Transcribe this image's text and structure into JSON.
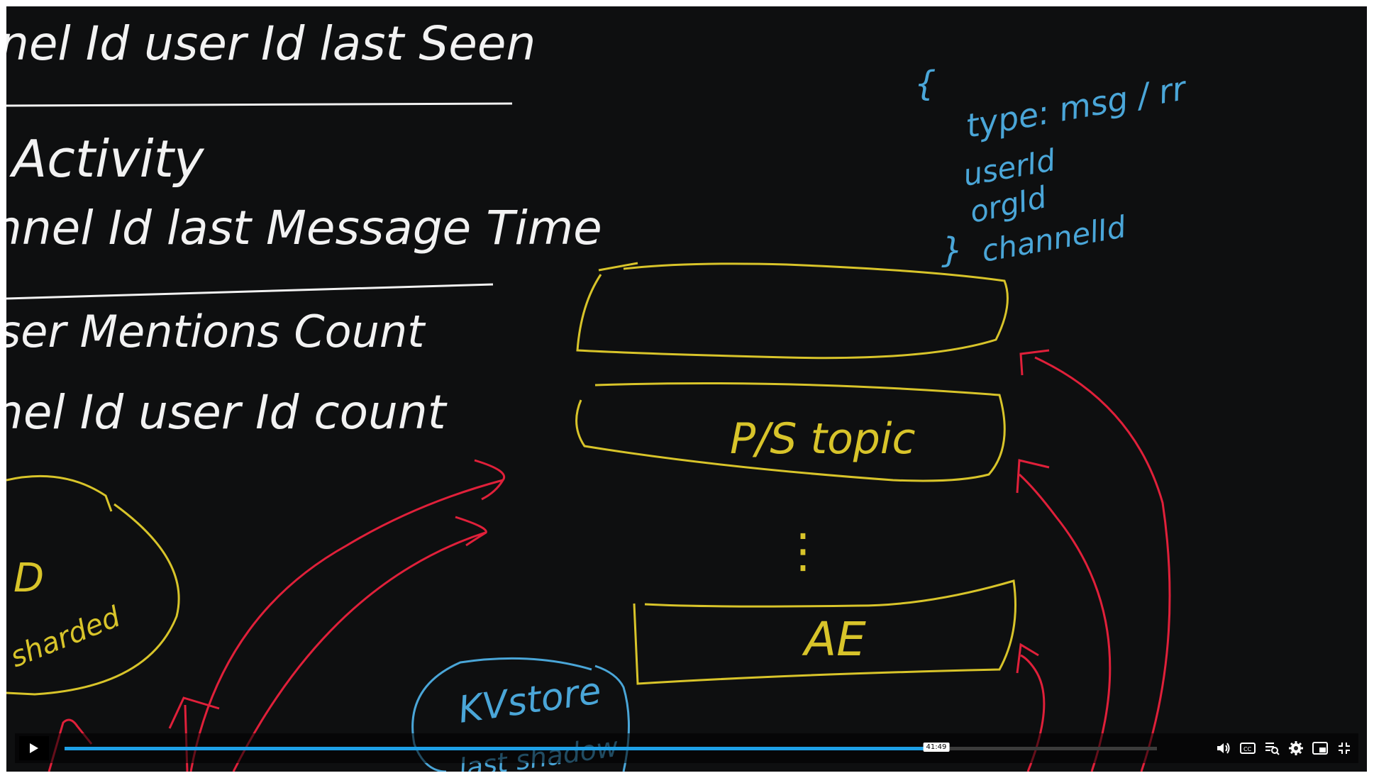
{
  "whiteboard": {
    "table_rows": [
      "nel Id   user Id   last Seen",
      "Activity",
      "nnel Id    last Message Time",
      "ser  Mentions  Count",
      "nel Id  user Id  count"
    ],
    "db_label": "D",
    "db_note": "sharded",
    "message_fields": [
      "type: msg / rr",
      "userId",
      "orgId",
      "channelId"
    ],
    "open_brace": "{",
    "close_brace": "}",
    "topic_label": "P/S topic",
    "ellipsis": "⋮",
    "ae_label": "AE",
    "kv_label": "KVstore",
    "kv_sub": "last shadow"
  },
  "colors": {
    "background": "#0e0f10",
    "chalk_white": "#f2f2f2",
    "yellow": "#d8c42a",
    "blue": "#4aa6d8",
    "red": "#e0203a",
    "progress": "#1ea0e6"
  },
  "player": {
    "progress_fraction": 0.798,
    "timestamp": "41:49",
    "icons": [
      "play-icon",
      "volume-icon",
      "captions-icon",
      "transcript-icon",
      "settings-icon",
      "pip-icon",
      "exit-fullscreen-icon"
    ]
  }
}
